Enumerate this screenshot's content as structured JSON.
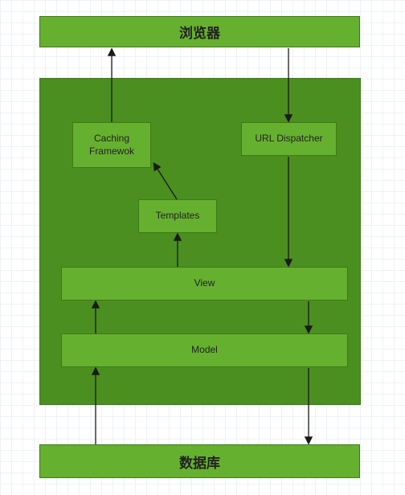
{
  "nodes": {
    "browser": "浏览器",
    "caching": "Caching\nFramewok",
    "url": "URL Dispatcher",
    "templates": "Templates",
    "view": "View",
    "model": "Model",
    "database": "数据库"
  }
}
